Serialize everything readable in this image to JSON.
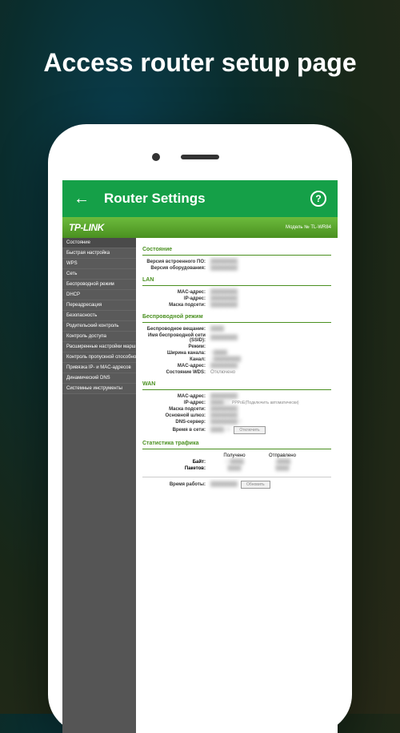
{
  "hero": "Access router setup page",
  "appbar": {
    "title": "Router Settings"
  },
  "router": {
    "logo": "TP-LINK",
    "model_label": "Модель № TL-WR84"
  },
  "menu": [
    "Состояние",
    "Быстрая настройка",
    "WPS",
    "Сеть",
    "Беспроводной режим",
    "DHCP",
    "Переадресация",
    "Безопасность",
    "Родительский контроль",
    "Контроль доступа",
    "Расширенные настройки маршрутизации",
    "Контроль пропускной способности",
    "Привязка IP- и MAC-адресов",
    "Динамический DNS",
    "Системные инструменты"
  ],
  "section_status": "Состояние",
  "fields_status": {
    "firmware": "Версия встроенного ПО:",
    "firmware_val": "████████",
    "hardware": "Версия оборудования:",
    "hardware_val": "████████"
  },
  "section_lan": "LAN",
  "fields_lan": {
    "mac": "MAC-адрес:",
    "mac_val": "████████",
    "ip": "IP-адрес:",
    "ip_val": "████████",
    "mask": "Маска подсети:",
    "mask_val": "████████"
  },
  "section_wifi": "Беспроводной режим",
  "fields_wifi": {
    "broadcast": "Беспроводное вещание:",
    "broadcast_val": "████",
    "ssid": "Имя беспроводной сети (SSID):",
    "ssid_val": "████████",
    "mode": "Режим:",
    "mode_val": "",
    "width": "Ширина канала:",
    "width_val": "А████",
    "channel": "Канал:",
    "channel_val": "А████████",
    "mac": "MAC-адрес:",
    "mac_val": "████████",
    "wds": "Состояние WDS:",
    "wds_val": "Отключено"
  },
  "section_wan": "WAN",
  "fields_wan": {
    "mac": "MAC-адрес:",
    "mac_val": "████████",
    "ip": "IP-адрес:",
    "ip_val": "████.47",
    "ip_extra": "PPPoE(Подключить автоматически)",
    "mask": "Маска подсети:",
    "mask_val": "████████",
    "gateway": "Основной шлюз:",
    "gateway_val": "████████",
    "dns": "DNS-сервер:",
    "dns_val": "████████.4",
    "uptime": "Время в сети:",
    "uptime_val": "████.39",
    "disconnect_btn": "Отключить"
  },
  "section_stats": "Статистика трафика",
  "stats": {
    "recv_header": "Получено",
    "sent_header": "Отправлено",
    "bytes_label": "Байт:",
    "bytes_recv": "10████",
    "bytes_sent": "2████",
    "packets_label": "Пакетов:",
    "packets_recv": "████",
    "packets_sent": "████"
  },
  "fields_uptime": {
    "label": "Время работы:",
    "val": "████████",
    "refresh_btn": "Обновить"
  }
}
